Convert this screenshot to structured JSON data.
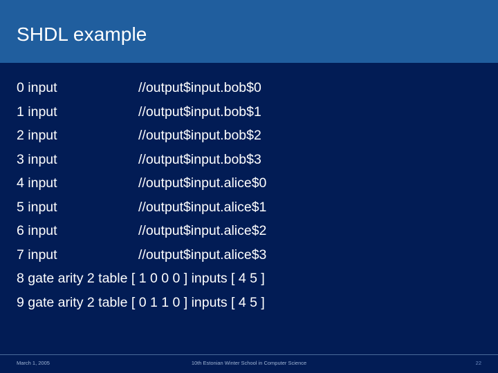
{
  "slide": {
    "title": "SHDL example",
    "colors": {
      "header_band": "#205e9e",
      "body_background": "#021c55",
      "title_text": "#ffffff",
      "body_text": "#ffffff",
      "footer_text": "#9fb4d4",
      "footer_rule": "#4a6b9a"
    }
  },
  "code": {
    "lines": [
      {
        "decl": "0 input",
        "comment": "//output$input.bob$0"
      },
      {
        "decl": "1 input",
        "comment": "//output$input.bob$1"
      },
      {
        "decl": "2 input",
        "comment": "//output$input.bob$2"
      },
      {
        "decl": "3 input",
        "comment": "//output$input.bob$3"
      },
      {
        "decl": "4 input",
        "comment": "//output$input.alice$0"
      },
      {
        "decl": "5 input",
        "comment": "//output$input.alice$1"
      },
      {
        "decl": "6 input",
        "comment": "//output$input.alice$2"
      },
      {
        "decl": "7 input",
        "comment": "//output$input.alice$3"
      },
      {
        "full": "8 gate arity 2 table [ 1 0 0 0 ] inputs [ 4 5 ]"
      },
      {
        "full": "9 gate arity 2 table [ 0 1 1 0 ] inputs [ 4 5 ]"
      }
    ]
  },
  "footer": {
    "date": "March 1, 2005",
    "event": "10th Estonian Winter School in Computer Science",
    "page_number": "22"
  }
}
